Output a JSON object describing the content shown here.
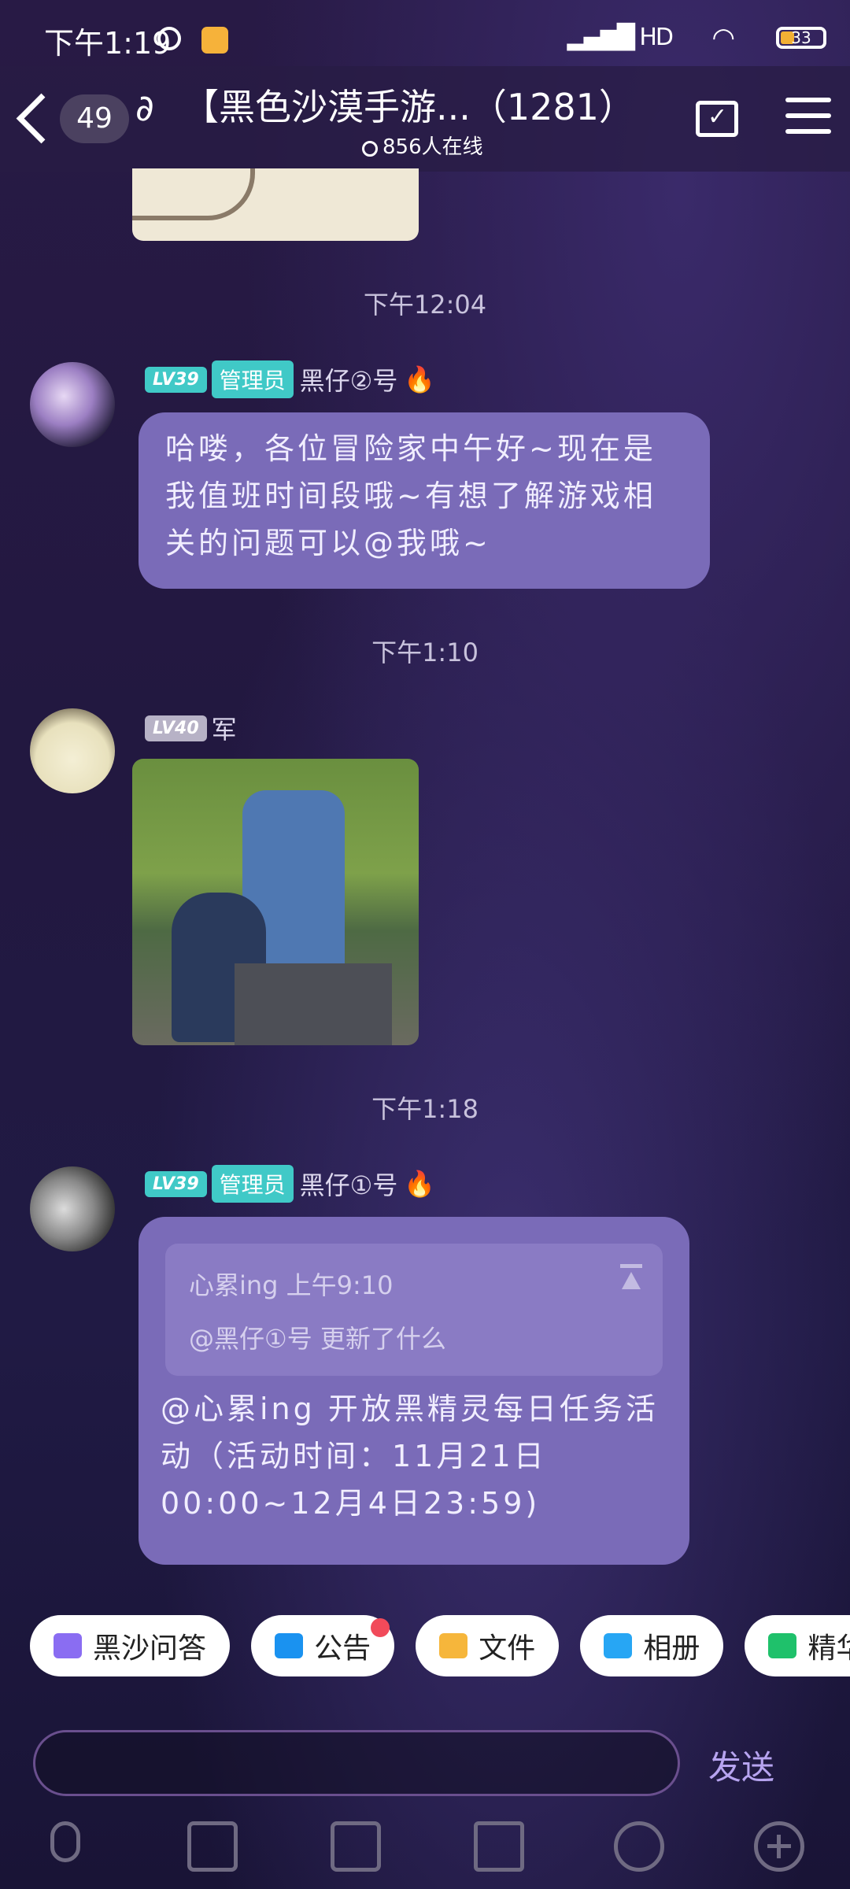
{
  "status": {
    "time": "下午1:19",
    "signal": "HD",
    "battery": "33"
  },
  "header": {
    "back_count": "49",
    "title": "【黑色沙漠手游...（1281）",
    "online": "856人在线"
  },
  "messages": [
    {
      "timestamp": "下午12:04"
    },
    {
      "level": "LV39",
      "role": "管理员",
      "sender": "黑仔②号",
      "text": "哈喽，各位冒险家中午好~现在是我值班时间段哦~有想了解游戏相关的问题可以@我哦~"
    },
    {
      "timestamp": "下午1:10"
    },
    {
      "level": "LV40",
      "sender": "军"
    },
    {
      "timestamp": "下午1:18"
    },
    {
      "level": "LV39",
      "role": "管理员",
      "sender": "黑仔①号",
      "quote_header": "心累ing 上午9:10",
      "quote_text": "@黑仔①号 更新了什么",
      "text": "@心累ing 开放黑精灵每日任务活动（活动时间：11月21日00:00~12月4日23:59)"
    }
  ],
  "quick_actions": [
    {
      "label": "黑沙问答",
      "icon": "qa-icon"
    },
    {
      "label": "公告",
      "icon": "announcement-icon"
    },
    {
      "label": "文件",
      "icon": "folder-icon"
    },
    {
      "label": "相册",
      "icon": "album-icon"
    },
    {
      "label": "精华消",
      "icon": "essence-icon"
    }
  ],
  "input": {
    "value": "",
    "placeholder": ""
  },
  "send_label": "发送"
}
